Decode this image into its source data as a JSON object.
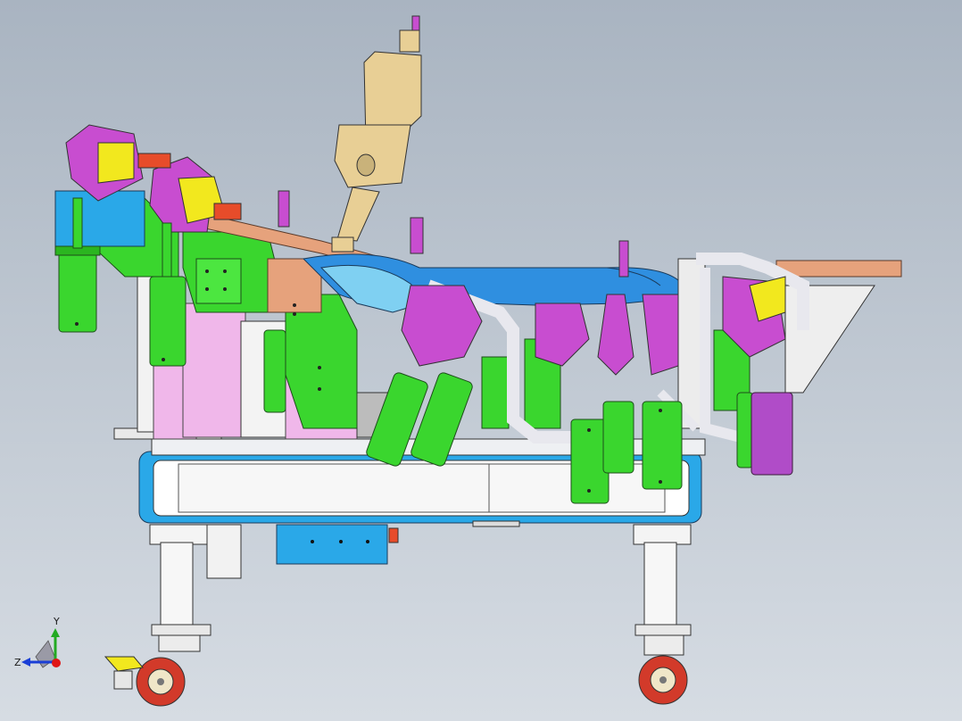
{
  "viewport": {
    "background_top": "#a9b4c1",
    "background_bottom": "#d6dce3"
  },
  "triad": {
    "y_label": "Y",
    "z_label": "Z",
    "y_color": "#22aa22",
    "z_color": "#1a3fd6",
    "x_color": "#e01515"
  },
  "colors": {
    "clamp_cylinder": "#3ad62e",
    "clamp_arm": "#c84dd0",
    "clamp_block": "#f2e81e",
    "base_plate": "#ffffff",
    "frame_blue": "#2aa8e8",
    "part_blue": "#2f8fe0",
    "bracket_pink": "#f0b7ea",
    "welding_gun": "#e8cf95",
    "pipe": "#e8e8ee",
    "wheel": "#d23a2a",
    "copper_rail": "#e6a27c"
  }
}
